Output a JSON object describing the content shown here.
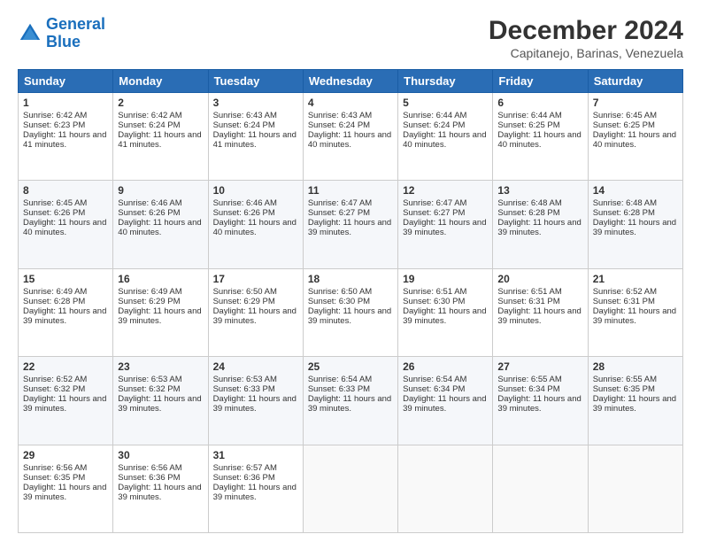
{
  "header": {
    "logo_line1": "General",
    "logo_line2": "Blue",
    "title": "December 2024",
    "subtitle": "Capitanejo, Barinas, Venezuela"
  },
  "calendar": {
    "headers": [
      "Sunday",
      "Monday",
      "Tuesday",
      "Wednesday",
      "Thursday",
      "Friday",
      "Saturday"
    ],
    "weeks": [
      [
        {
          "day": "",
          "empty": true
        },
        {
          "day": "",
          "empty": true
        },
        {
          "day": "",
          "empty": true
        },
        {
          "day": "",
          "empty": true
        },
        {
          "day": "",
          "empty": true
        },
        {
          "day": "",
          "empty": true
        },
        {
          "day": "",
          "empty": true
        }
      ],
      [
        {
          "day": "1",
          "sunrise": "6:42 AM",
          "sunset": "6:23 PM",
          "daylight": "11 hours and 41 minutes."
        },
        {
          "day": "2",
          "sunrise": "6:42 AM",
          "sunset": "6:24 PM",
          "daylight": "11 hours and 41 minutes."
        },
        {
          "day": "3",
          "sunrise": "6:43 AM",
          "sunset": "6:24 PM",
          "daylight": "11 hours and 41 minutes."
        },
        {
          "day": "4",
          "sunrise": "6:43 AM",
          "sunset": "6:24 PM",
          "daylight": "11 hours and 40 minutes."
        },
        {
          "day": "5",
          "sunrise": "6:44 AM",
          "sunset": "6:24 PM",
          "daylight": "11 hours and 40 minutes."
        },
        {
          "day": "6",
          "sunrise": "6:44 AM",
          "sunset": "6:25 PM",
          "daylight": "11 hours and 40 minutes."
        },
        {
          "day": "7",
          "sunrise": "6:45 AM",
          "sunset": "6:25 PM",
          "daylight": "11 hours and 40 minutes."
        }
      ],
      [
        {
          "day": "8",
          "sunrise": "6:45 AM",
          "sunset": "6:26 PM",
          "daylight": "11 hours and 40 minutes."
        },
        {
          "day": "9",
          "sunrise": "6:46 AM",
          "sunset": "6:26 PM",
          "daylight": "11 hours and 40 minutes."
        },
        {
          "day": "10",
          "sunrise": "6:46 AM",
          "sunset": "6:26 PM",
          "daylight": "11 hours and 40 minutes."
        },
        {
          "day": "11",
          "sunrise": "6:47 AM",
          "sunset": "6:27 PM",
          "daylight": "11 hours and 39 minutes."
        },
        {
          "day": "12",
          "sunrise": "6:47 AM",
          "sunset": "6:27 PM",
          "daylight": "11 hours and 39 minutes."
        },
        {
          "day": "13",
          "sunrise": "6:48 AM",
          "sunset": "6:28 PM",
          "daylight": "11 hours and 39 minutes."
        },
        {
          "day": "14",
          "sunrise": "6:48 AM",
          "sunset": "6:28 PM",
          "daylight": "11 hours and 39 minutes."
        }
      ],
      [
        {
          "day": "15",
          "sunrise": "6:49 AM",
          "sunset": "6:28 PM",
          "daylight": "11 hours and 39 minutes."
        },
        {
          "day": "16",
          "sunrise": "6:49 AM",
          "sunset": "6:29 PM",
          "daylight": "11 hours and 39 minutes."
        },
        {
          "day": "17",
          "sunrise": "6:50 AM",
          "sunset": "6:29 PM",
          "daylight": "11 hours and 39 minutes."
        },
        {
          "day": "18",
          "sunrise": "6:50 AM",
          "sunset": "6:30 PM",
          "daylight": "11 hours and 39 minutes."
        },
        {
          "day": "19",
          "sunrise": "6:51 AM",
          "sunset": "6:30 PM",
          "daylight": "11 hours and 39 minutes."
        },
        {
          "day": "20",
          "sunrise": "6:51 AM",
          "sunset": "6:31 PM",
          "daylight": "11 hours and 39 minutes."
        },
        {
          "day": "21",
          "sunrise": "6:52 AM",
          "sunset": "6:31 PM",
          "daylight": "11 hours and 39 minutes."
        }
      ],
      [
        {
          "day": "22",
          "sunrise": "6:52 AM",
          "sunset": "6:32 PM",
          "daylight": "11 hours and 39 minutes."
        },
        {
          "day": "23",
          "sunrise": "6:53 AM",
          "sunset": "6:32 PM",
          "daylight": "11 hours and 39 minutes."
        },
        {
          "day": "24",
          "sunrise": "6:53 AM",
          "sunset": "6:33 PM",
          "daylight": "11 hours and 39 minutes."
        },
        {
          "day": "25",
          "sunrise": "6:54 AM",
          "sunset": "6:33 PM",
          "daylight": "11 hours and 39 minutes."
        },
        {
          "day": "26",
          "sunrise": "6:54 AM",
          "sunset": "6:34 PM",
          "daylight": "11 hours and 39 minutes."
        },
        {
          "day": "27",
          "sunrise": "6:55 AM",
          "sunset": "6:34 PM",
          "daylight": "11 hours and 39 minutes."
        },
        {
          "day": "28",
          "sunrise": "6:55 AM",
          "sunset": "6:35 PM",
          "daylight": "11 hours and 39 minutes."
        }
      ],
      [
        {
          "day": "29",
          "sunrise": "6:56 AM",
          "sunset": "6:35 PM",
          "daylight": "11 hours and 39 minutes."
        },
        {
          "day": "30",
          "sunrise": "6:56 AM",
          "sunset": "6:36 PM",
          "daylight": "11 hours and 39 minutes."
        },
        {
          "day": "31",
          "sunrise": "6:57 AM",
          "sunset": "6:36 PM",
          "daylight": "11 hours and 39 minutes."
        },
        {
          "day": "",
          "empty": true
        },
        {
          "day": "",
          "empty": true
        },
        {
          "day": "",
          "empty": true
        },
        {
          "day": "",
          "empty": true
        }
      ]
    ]
  }
}
